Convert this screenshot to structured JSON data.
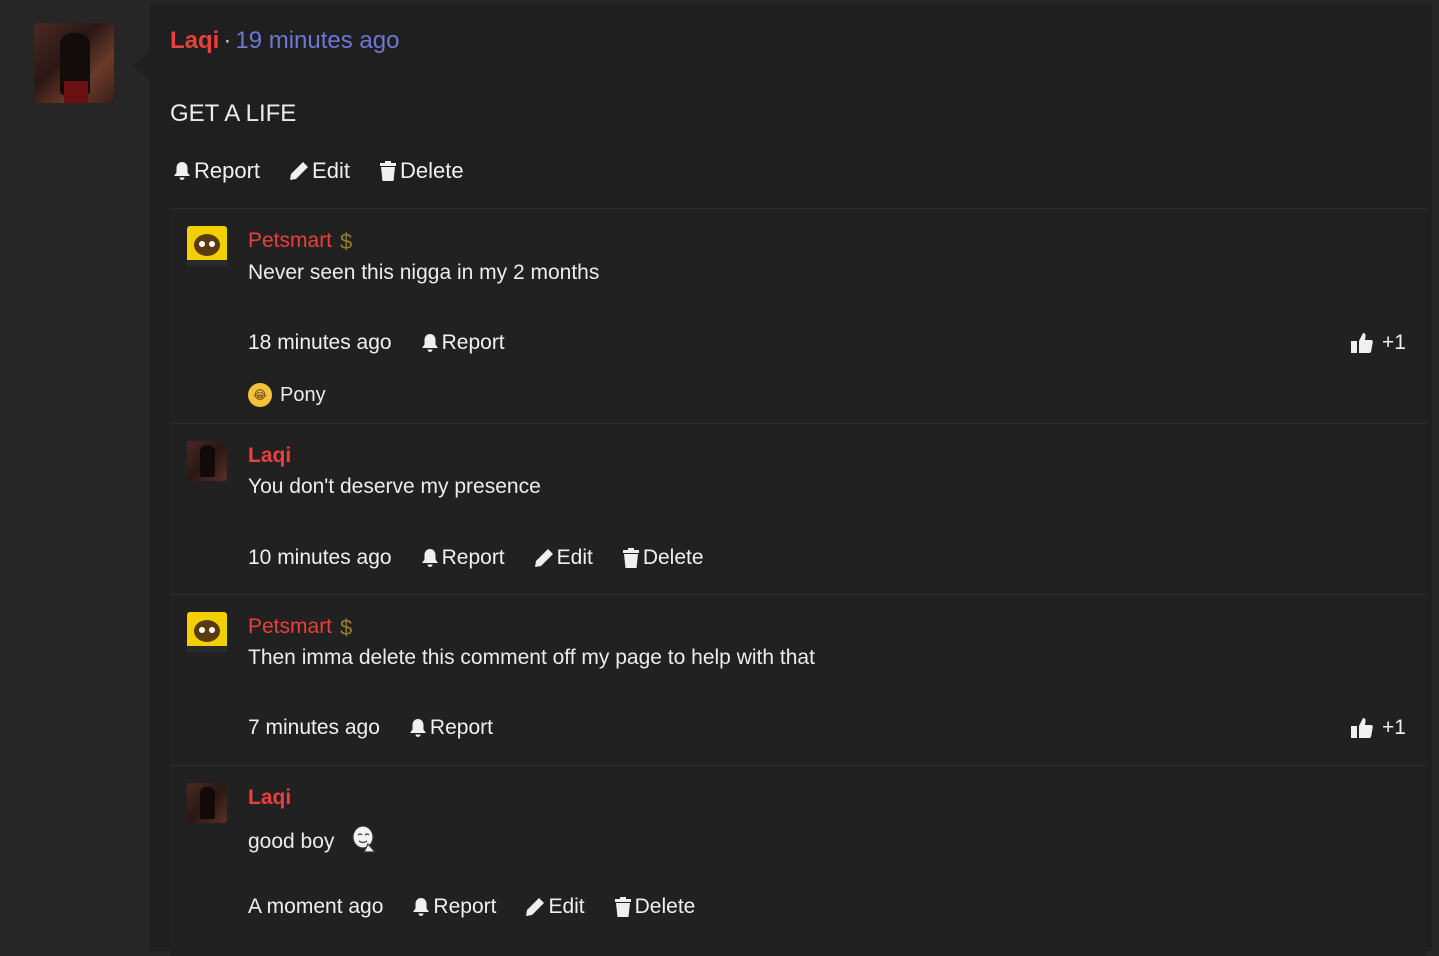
{
  "post": {
    "author": "Laqi",
    "separator": "·",
    "time": "19 minutes ago",
    "body": "GET A LIFE",
    "actions": {
      "report": "Report",
      "edit": "Edit",
      "delete": "Delete"
    }
  },
  "replies": [
    {
      "author": "Petsmart",
      "badge_icon": "dollar-icon",
      "text": "Never seen this nigga in my 2 months",
      "time": "18 minutes ago",
      "report": "Report",
      "like_count": "+1",
      "reaction": {
        "icon": "laughing-crying-emoji",
        "label": "Pony"
      }
    },
    {
      "author": "Laqi",
      "text": "You don't deserve my presence",
      "time": "10 minutes ago",
      "report": "Report",
      "edit": "Edit",
      "delete": "Delete"
    },
    {
      "author": "Petsmart",
      "badge_icon": "dollar-icon",
      "text": "Then imma delete this comment off my page to help with that",
      "time": "7 minutes ago",
      "report": "Report",
      "like_count": "+1"
    },
    {
      "author": "Laqi",
      "text": "good boy",
      "text_icon": "meme-face-icon",
      "time": "A moment ago",
      "report": "Report",
      "edit": "Edit",
      "delete": "Delete"
    }
  ],
  "colors": {
    "author": "#e8403a",
    "time_link": "#6f76d6",
    "panel_bg": "#1f1f1f",
    "page_bg": "#262626",
    "badge": "#9c7a30"
  }
}
